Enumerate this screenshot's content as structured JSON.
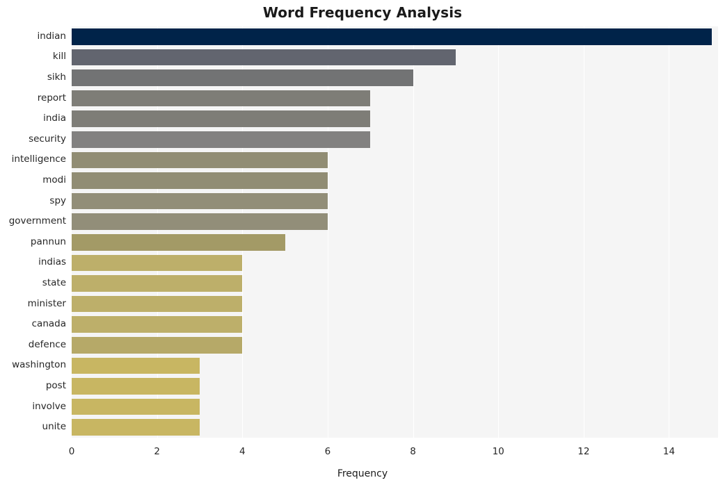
{
  "chart_data": {
    "type": "bar",
    "orientation": "horizontal",
    "title": "Word Frequency Analysis",
    "xlabel": "Frequency",
    "ylabel": "",
    "xlim": [
      0,
      15.15
    ],
    "xticks": [
      0,
      2,
      4,
      6,
      8,
      10,
      12,
      14
    ],
    "xtick_labels": [
      "0",
      "2",
      "4",
      "6",
      "8",
      "10",
      "12",
      "14"
    ],
    "grid": "vertical",
    "legend": "none",
    "categories": [
      "indian",
      "kill",
      "sikh",
      "report",
      "india",
      "security",
      "intelligence",
      "modi",
      "spy",
      "government",
      "pannun",
      "indias",
      "state",
      "minister",
      "canada",
      "defence",
      "washington",
      "post",
      "involve",
      "unite"
    ],
    "values": [
      15,
      9,
      8,
      7,
      7,
      7,
      6,
      6,
      6,
      6,
      5,
      4,
      4,
      4,
      4,
      4,
      3,
      3,
      3,
      3
    ],
    "bar_colors": [
      "#002349",
      "#62656f",
      "#727374",
      "#7e7d77",
      "#7e7d77",
      "#828180",
      "#918d74",
      "#918d74",
      "#928e78",
      "#928e79",
      "#a39a66",
      "#bdaf6a",
      "#bdaf6a",
      "#bdaf6a",
      "#bdaf6a",
      "#b6a968",
      "#c8b662",
      "#c8b662",
      "#c8b662",
      "#c8b662"
    ],
    "plot_background": "#f5f5f5",
    "figure_background": "#ffffff",
    "gridline_color": "#ffffff"
  },
  "chart": {
    "title": "Word Frequency Analysis",
    "x_axis_title": "Frequency"
  }
}
